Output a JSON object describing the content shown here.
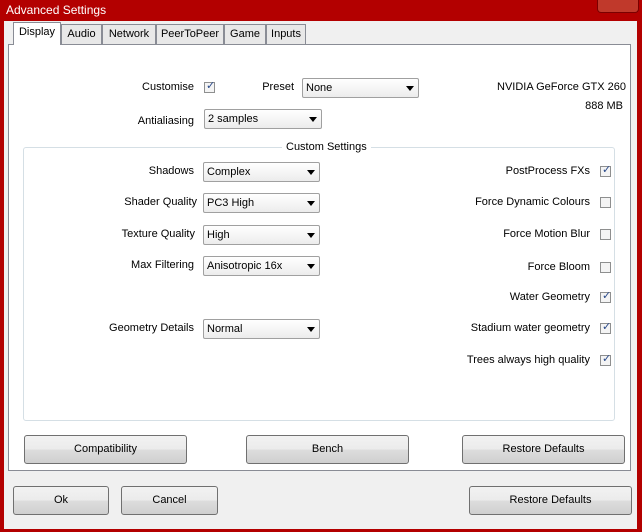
{
  "window": {
    "title": "Advanced Settings"
  },
  "tabs": [
    {
      "label": "Display",
      "active": true
    },
    {
      "label": "Audio"
    },
    {
      "label": "Network"
    },
    {
      "label": "PeerToPeer"
    },
    {
      "label": "Game"
    },
    {
      "label": "Inputs"
    }
  ],
  "display": {
    "customise_label": "Customise",
    "customise_checked": true,
    "preset_label": "Preset",
    "preset_value": "None",
    "antialiasing_label": "Antialiasing",
    "antialiasing_value": "2 samples",
    "gpu_name": "NVIDIA GeForce GTX 260",
    "gpu_memory": "888 MB",
    "custom_settings_title": "Custom Settings",
    "shadows_label": "Shadows",
    "shadows_value": "Complex",
    "shader_label": "Shader Quality",
    "shader_value": "PC3 High",
    "texture_label": "Texture Quality",
    "texture_value": "High",
    "filtering_label": "Max Filtering",
    "filtering_value": "Anisotropic 16x",
    "geometry_label": "Geometry Details",
    "geometry_value": "Normal",
    "checkboxes": [
      {
        "label": "PostProcess FXs",
        "checked": true
      },
      {
        "label": "Force Dynamic Colours",
        "checked": false
      },
      {
        "label": "Force Motion Blur",
        "checked": false
      },
      {
        "label": "Force Bloom",
        "checked": false
      },
      {
        "label": "Water Geometry",
        "checked": true
      },
      {
        "label": "Stadium water geometry",
        "checked": true
      },
      {
        "label": "Trees always high quality",
        "checked": true
      }
    ],
    "compatibility_label": "Compatibility",
    "bench_label": "Bench",
    "restore_label": "Restore Defaults"
  },
  "footer": {
    "ok_label": "Ok",
    "cancel_label": "Cancel",
    "restore_label": "Restore Defaults"
  }
}
